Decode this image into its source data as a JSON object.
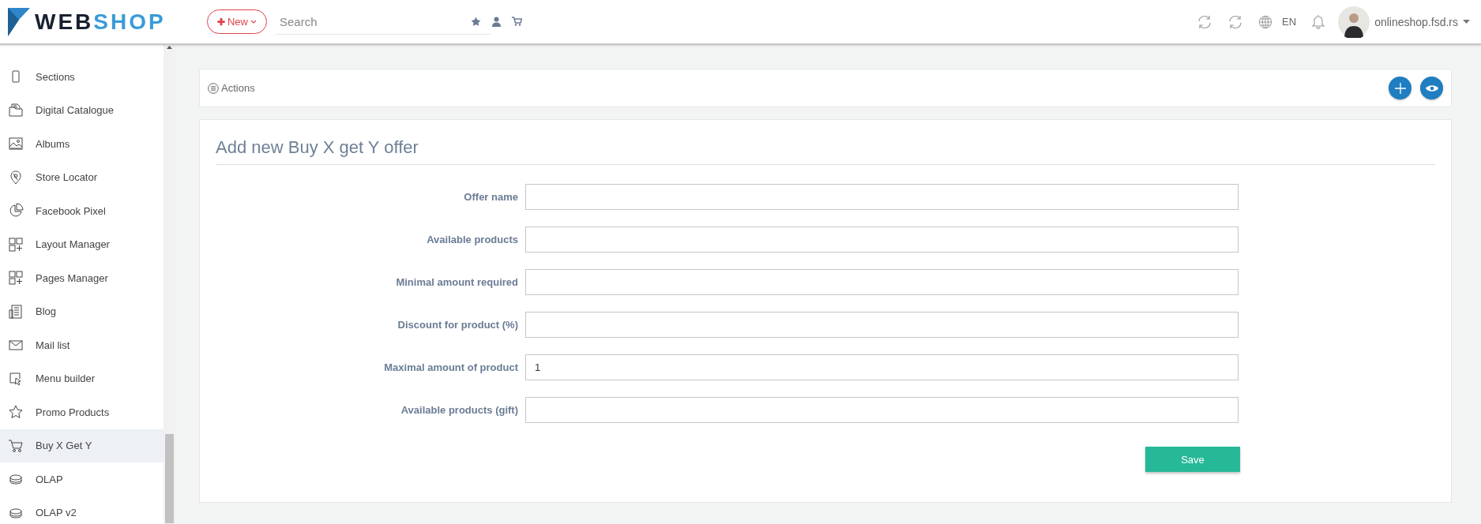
{
  "header": {
    "logo": {
      "part_1": "WEB",
      "part_2": "SHOP"
    },
    "new_button": {
      "icon": "✚",
      "label": "New"
    },
    "search": {
      "placeholder": "Search"
    },
    "language": "EN",
    "account": "onlineshop.fsd.rs"
  },
  "sidebar": {
    "items": [
      {
        "label": "Sections",
        "selected": false
      },
      {
        "label": "Digital Catalogue",
        "selected": false
      },
      {
        "label": "Albums",
        "selected": false
      },
      {
        "label": "Store Locator",
        "selected": false
      },
      {
        "label": "Facebook Pixel",
        "selected": false
      },
      {
        "label": "Layout Manager",
        "selected": false
      },
      {
        "label": "Pages Manager",
        "selected": false
      },
      {
        "label": "Blog",
        "selected": false
      },
      {
        "label": "Mail list",
        "selected": false
      },
      {
        "label": "Menu builder",
        "selected": false
      },
      {
        "label": "Promo Products",
        "selected": false
      },
      {
        "label": "Buy X Get Y",
        "selected": true
      },
      {
        "label": "OLAP",
        "selected": false
      },
      {
        "label": "OLAP v2",
        "selected": false
      }
    ]
  },
  "actions": {
    "label": "Actions"
  },
  "form": {
    "title": "Add new Buy X get Y offer",
    "fields": [
      {
        "label": "Offer name"
      },
      {
        "label": "Available products"
      },
      {
        "label": "Minimal amount required"
      },
      {
        "label": "Discount for product (%)"
      },
      {
        "label": "Maximal amount of product",
        "value": "1"
      },
      {
        "label": "Available products (gift)"
      }
    ],
    "save": "Save"
  }
}
